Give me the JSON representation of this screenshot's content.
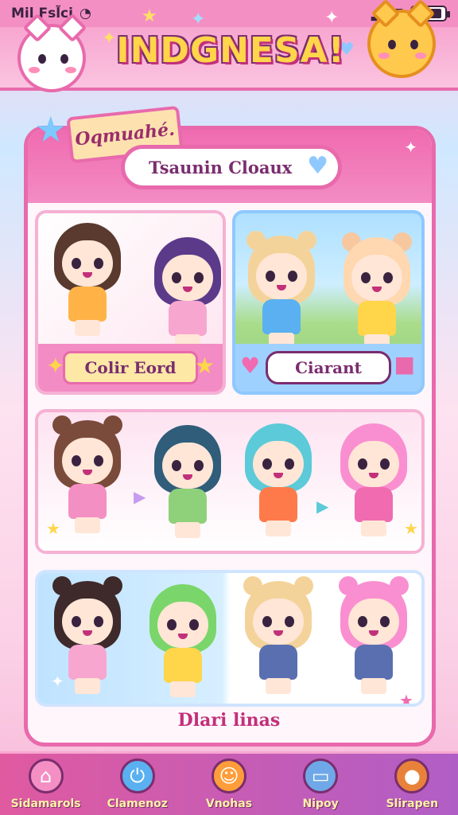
{
  "status_bar": {
    "carrier": "Mil Fsl̃ci",
    "battery_level": 0.92
  },
  "header": {
    "title": "INDGNESA!"
  },
  "panel": {
    "ribbon_text": "Oqmuahé.",
    "search_text": "Tsaunin Cloaux"
  },
  "cards": {
    "a_label": "Colir Eord",
    "b_label": "Ciarant"
  },
  "footer_caption": "Dlari linas",
  "bottom_nav": {
    "items": [
      {
        "label": "Sidamarols",
        "icon": "home-icon",
        "color": "#f48fc4"
      },
      {
        "label": "Clamenoz",
        "icon": "power-icon",
        "color": "#5ab0f0"
      },
      {
        "label": "Vnohas",
        "icon": "smiley-icon",
        "color": "#ff9d3a"
      },
      {
        "label": "Nipoy",
        "icon": "monitor-icon",
        "color": "#6fa8e8"
      },
      {
        "label": "Slirapen",
        "icon": "profile-icon",
        "color": "#e8823a"
      }
    ]
  },
  "colors": {
    "accent_pink": "#e86aac",
    "sky_blue": "#8fc8ff",
    "gold": "#ffd54a"
  }
}
